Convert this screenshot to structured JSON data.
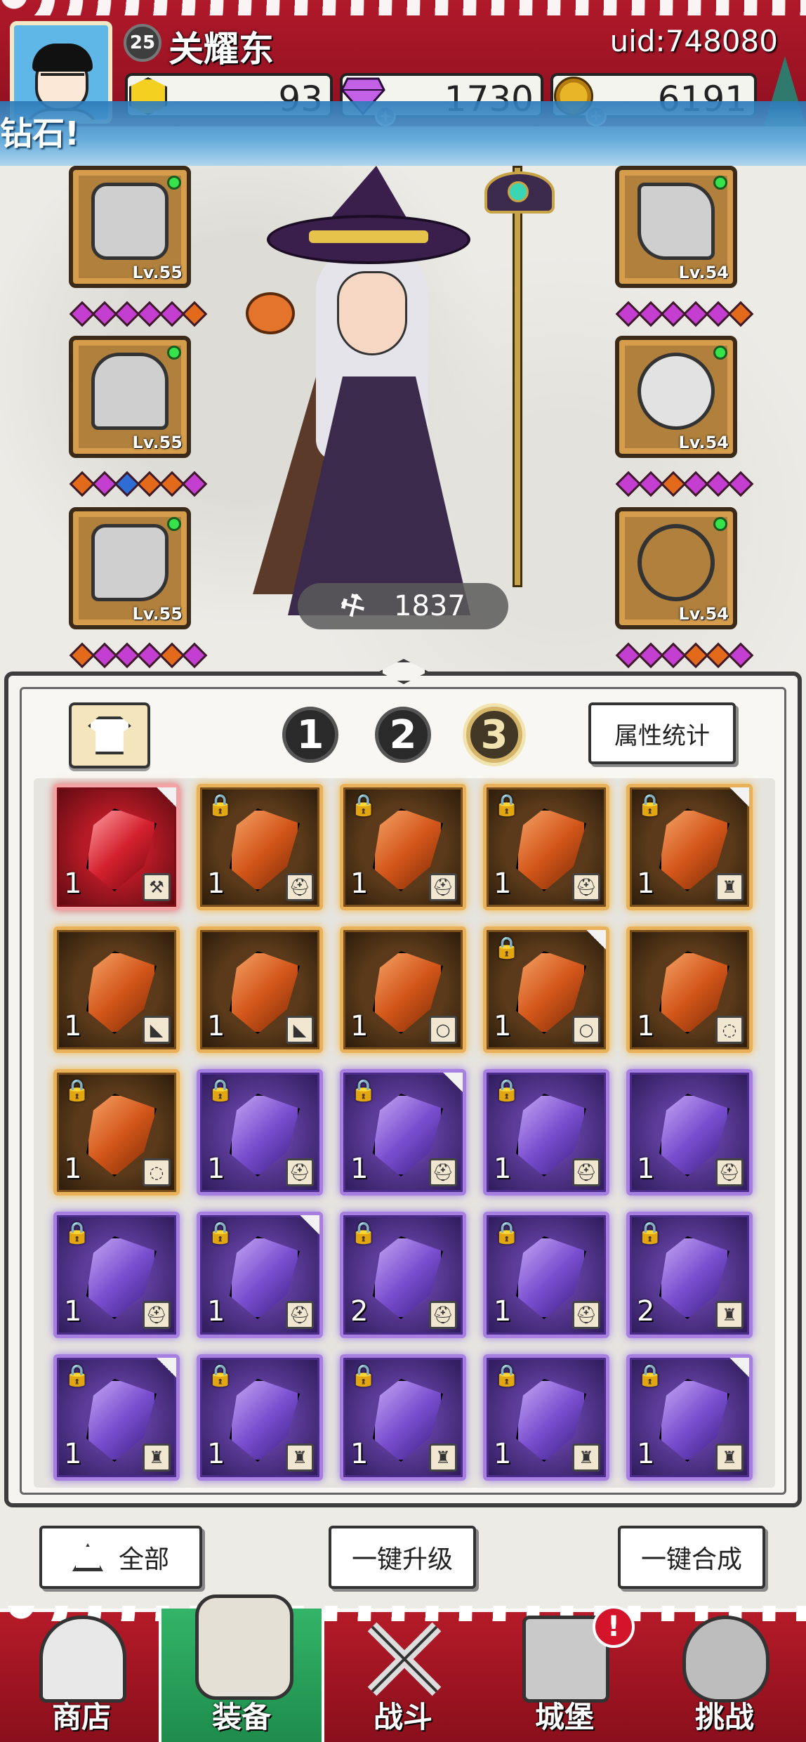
{
  "header": {
    "level": "25",
    "player_name": "关耀东",
    "uid": "uid:748080",
    "currencies": [
      {
        "name": "gold-gem",
        "value": "93",
        "icon": "hexagon-gold-icon"
      },
      {
        "name": "diamond",
        "value": "1730",
        "icon": "diamond-icon"
      },
      {
        "name": "coin",
        "value": "6191",
        "icon": "coin-icon"
      }
    ]
  },
  "banner": {
    "text": "钻石!"
  },
  "equipment": {
    "left": [
      {
        "icon": "helmet-icon",
        "level": "Lv.55"
      },
      {
        "icon": "armor-icon",
        "level": "Lv.55"
      },
      {
        "icon": "boots-icon",
        "level": "Lv.55"
      }
    ],
    "right": [
      {
        "icon": "gauntlet-icon",
        "level": "Lv.54"
      },
      {
        "icon": "ring-icon",
        "level": "Lv.54"
      },
      {
        "icon": "necklace-icon",
        "level": "Lv.54"
      }
    ]
  },
  "power": {
    "value": "1837"
  },
  "inventory": {
    "tabs": [
      "1",
      "2",
      "3"
    ],
    "active_tab": "3",
    "stats_button": "属性统计",
    "items": [
      {
        "rarity": "red",
        "locked": false,
        "qty": "1",
        "type": "hammer-icon",
        "type_glyph": "⚒"
      },
      {
        "rarity": "orange",
        "locked": true,
        "qty": "1",
        "type": "helmet-icon",
        "type_glyph": "⛑"
      },
      {
        "rarity": "orange",
        "locked": true,
        "qty": "1",
        "type": "helmet-icon",
        "type_glyph": "⛑"
      },
      {
        "rarity": "orange",
        "locked": true,
        "qty": "1",
        "type": "helmet-icon",
        "type_glyph": "⛑"
      },
      {
        "rarity": "orange",
        "locked": true,
        "qty": "1",
        "type": "armor-icon",
        "type_glyph": "♜"
      },
      {
        "rarity": "orange",
        "locked": false,
        "qty": "1",
        "type": "boots-icon",
        "type_glyph": "◣"
      },
      {
        "rarity": "orange",
        "locked": false,
        "qty": "1",
        "type": "boots-icon",
        "type_glyph": "◣"
      },
      {
        "rarity": "orange",
        "locked": false,
        "qty": "1",
        "type": "ring-icon",
        "type_glyph": "○"
      },
      {
        "rarity": "orange",
        "locked": true,
        "qty": "1",
        "type": "ring-icon",
        "type_glyph": "○"
      },
      {
        "rarity": "orange",
        "locked": false,
        "qty": "1",
        "type": "necklace-icon",
        "type_glyph": "◌"
      },
      {
        "rarity": "orange",
        "locked": true,
        "qty": "1",
        "type": "necklace-icon",
        "type_glyph": "◌"
      },
      {
        "rarity": "purple",
        "locked": true,
        "qty": "1",
        "type": "helmet-icon",
        "type_glyph": "⛑"
      },
      {
        "rarity": "purple",
        "locked": true,
        "qty": "1",
        "type": "helmet-icon",
        "type_glyph": "⛑"
      },
      {
        "rarity": "purple",
        "locked": true,
        "qty": "1",
        "type": "helmet-icon",
        "type_glyph": "⛑"
      },
      {
        "rarity": "purple",
        "locked": false,
        "qty": "1",
        "type": "helmet-icon",
        "type_glyph": "⛑"
      },
      {
        "rarity": "purple",
        "locked": true,
        "qty": "1",
        "type": "helmet-icon",
        "type_glyph": "⛑"
      },
      {
        "rarity": "purple",
        "locked": true,
        "qty": "1",
        "type": "helmet-icon",
        "type_glyph": "⛑"
      },
      {
        "rarity": "purple",
        "locked": true,
        "qty": "2",
        "type": "helmet-icon",
        "type_glyph": "⛑"
      },
      {
        "rarity": "purple",
        "locked": true,
        "qty": "1",
        "type": "helmet-icon",
        "type_glyph": "⛑"
      },
      {
        "rarity": "purple",
        "locked": true,
        "qty": "2",
        "type": "armor-icon",
        "type_glyph": "♜"
      },
      {
        "rarity": "purple",
        "locked": true,
        "qty": "1",
        "type": "armor-icon",
        "type_glyph": "♜"
      },
      {
        "rarity": "purple",
        "locked": true,
        "qty": "1",
        "type": "armor-icon",
        "type_glyph": "♜"
      },
      {
        "rarity": "purple",
        "locked": true,
        "qty": "1",
        "type": "armor-icon",
        "type_glyph": "♜"
      },
      {
        "rarity": "purple",
        "locked": true,
        "qty": "1",
        "type": "armor-icon",
        "type_glyph": "♜"
      },
      {
        "rarity": "purple",
        "locked": true,
        "qty": "1",
        "type": "armor-icon",
        "type_glyph": "♜"
      }
    ]
  },
  "actions": {
    "filter_all": "全部",
    "upgrade_all": "一键升级",
    "merge_all": "一键合成"
  },
  "nav": [
    {
      "label": "商店",
      "icon": "shop-hut-icon"
    },
    {
      "label": "装备",
      "icon": "backpack-icon"
    },
    {
      "label": "战斗",
      "icon": "crossed-swords-icon"
    },
    {
      "label": "城堡",
      "icon": "castle-icon",
      "badge": "!"
    },
    {
      "label": "挑战",
      "icon": "shield-icon"
    }
  ],
  "colors": {
    "header_red": "#b0192a",
    "nav_active_green": "#33b468",
    "rarity_orange": "#e9b25a",
    "rarity_purple": "#a77fe0",
    "rarity_red": "#d4202e"
  }
}
